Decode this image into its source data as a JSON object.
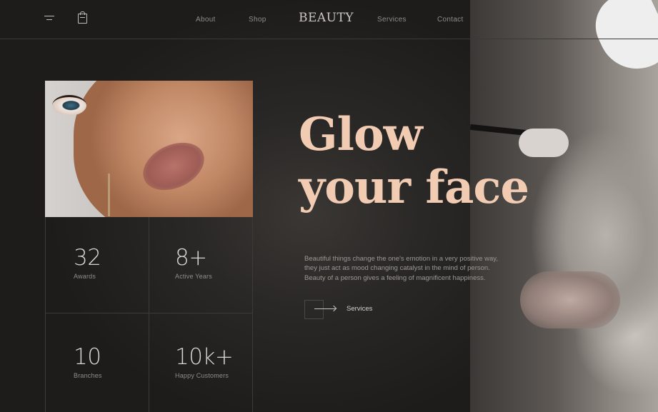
{
  "colors": {
    "background": "#1e1e1e",
    "accent": "#f1ccb3",
    "text_muted": "#8e8c8a"
  },
  "header": {
    "menu_icon": "hamburger-menu-icon",
    "bag_icon": "shopping-bag-icon",
    "brand": "BEAUTY",
    "nav": [
      {
        "label": "About"
      },
      {
        "label": "Shop"
      },
      {
        "label": "Services"
      },
      {
        "label": "Contact"
      }
    ]
  },
  "hero": {
    "title_line1": "Glow",
    "title_line2": "your face",
    "description": "Beautiful things change the one's emotion in a very positive way, they just act as mood changing catalyst in the mind of person. Beauty of a person gives a feeling of magnificent happiness.",
    "cta_label": "Services",
    "cta_icon": "arrow-right-icon"
  },
  "stats": [
    {
      "value": "32",
      "label": "Awards"
    },
    {
      "value": "8+",
      "label": "Active Years"
    },
    {
      "value": "10",
      "label": "Branches"
    },
    {
      "value": "10k+",
      "label": "Happy Customers"
    }
  ]
}
